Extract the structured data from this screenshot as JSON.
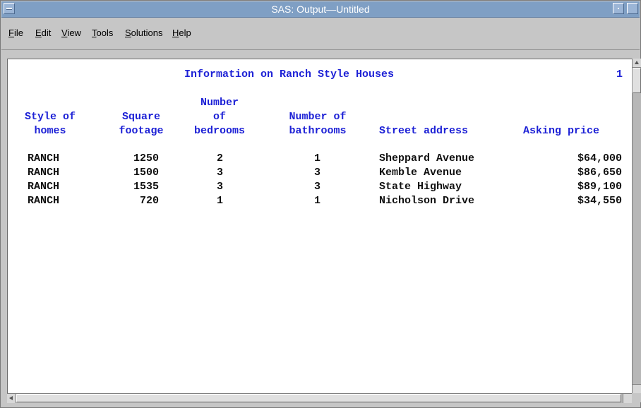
{
  "window": {
    "title": "SAS: Output—Untitled"
  },
  "menu": [
    "File",
    "Edit",
    "View",
    "Tools",
    "Solutions",
    "Help"
  ],
  "report": {
    "title": "Information on Ranch Style Houses",
    "page_number": "1",
    "headers": {
      "style": [
        "Style of",
        "homes"
      ],
      "sqfeet": [
        "Square",
        "footage"
      ],
      "bedrooms": [
        "Number",
        "of",
        "bedrooms"
      ],
      "baths": [
        "Number of",
        "bathrooms"
      ],
      "street": [
        "Street address"
      ],
      "price": [
        "Asking price"
      ]
    },
    "rows": [
      {
        "style": "RANCH",
        "sqfeet": "1250",
        "bedrooms": "2",
        "baths": "1",
        "street": "Sheppard Avenue",
        "price": "$64,000"
      },
      {
        "style": "RANCH",
        "sqfeet": "1500",
        "bedrooms": "3",
        "baths": "3",
        "street": "Kemble Avenue",
        "price": "$86,650"
      },
      {
        "style": "RANCH",
        "sqfeet": "1535",
        "bedrooms": "3",
        "baths": "3",
        "street": "State Highway",
        "price": "$89,100"
      },
      {
        "style": "RANCH",
        "sqfeet": "720",
        "bedrooms": "1",
        "baths": "1",
        "street": "Nicholson Drive",
        "price": "$34,550"
      }
    ]
  },
  "colors": {
    "header_text": "#1e22d6",
    "body_text": "#111111",
    "titlebar": "#7f9fc4"
  }
}
